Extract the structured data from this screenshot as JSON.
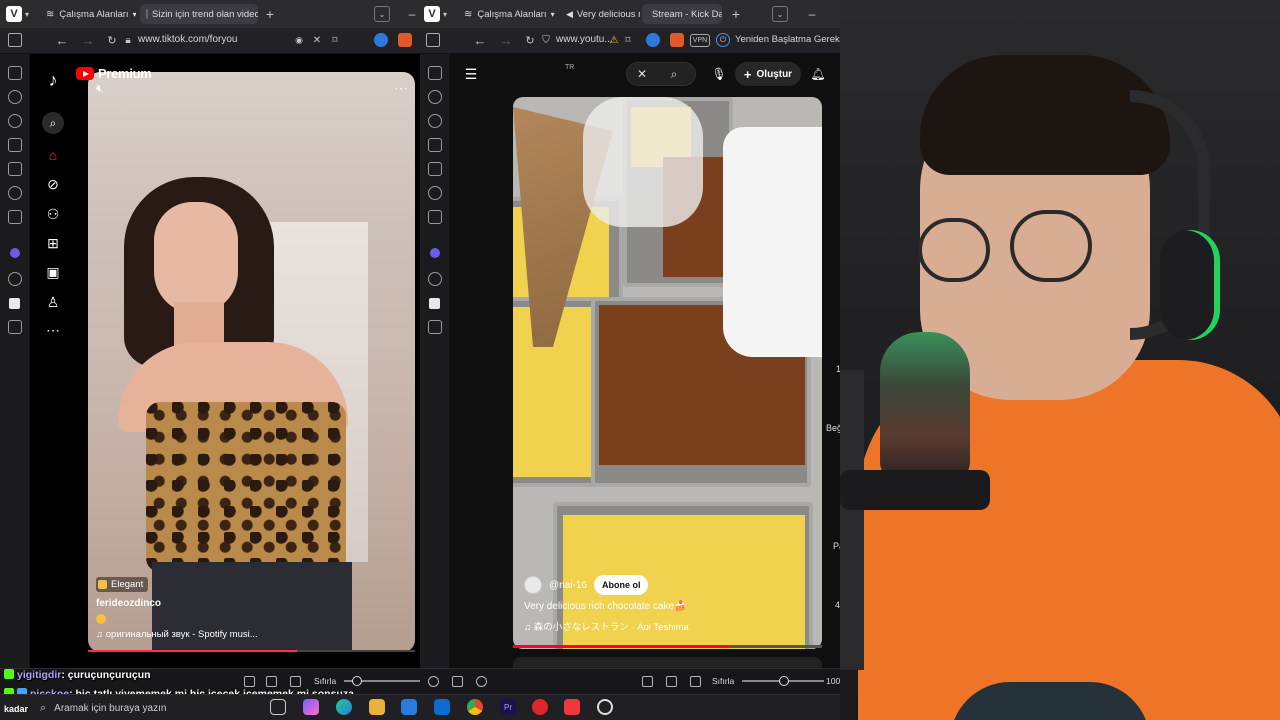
{
  "left_browser": {
    "tabs": [
      {
        "label": "Çalışma Alanları"
      },
      {
        "label": "Sizin için trend olan videolar"
      }
    ],
    "url": "www.tiktok.com/foryou"
  },
  "tiktok_video": {
    "badge": "Elegant",
    "username": "ferideozdinco",
    "sound": "оригинальный звук - Spotify musi...",
    "progress_percent": 64
  },
  "right_browser": {
    "tabs": [
      {
        "label": "Çalışma Alanları"
      },
      {
        "label": "Very delicious rich"
      },
      {
        "label": "Stream - Kick Das"
      }
    ],
    "url": "www.youtu...",
    "vpn_label": "VPN",
    "restart_notice": "Yeniden Başlatma Gerekli"
  },
  "youtube": {
    "brand": "Premium",
    "country": "TR",
    "create_label": "Oluştur",
    "channel": "@nai-16",
    "subscribe_label": "Abone ol",
    "title": "Very delicious rich chocolate cake🍰",
    "music": "♫ 森の小さなレストラン · Aoi Teshima",
    "progress_percent": 70,
    "edge_labels": [
      "1",
      "Beğ",
      "Pa",
      "4"
    ]
  },
  "obs": {
    "reset_label_left": "Sıfırla",
    "reset_label_right": "Sıfırla",
    "volume": "100",
    "left_slider_percent": 10,
    "right_slider_percent": 45
  },
  "chat": [
    {
      "user": "yigitigdir",
      "text": ": çuruçunçuruçun"
    },
    {
      "user": "picckoe",
      "text": ": hiç tatlı yiyememek mi hiç içecek içememek mi sonsuza"
    }
  ],
  "taskbar": {
    "search_placeholder": "Aramak için buraya yazın",
    "kadar": "kadar"
  },
  "colors": {
    "tiktok_red": "#fe2c55",
    "youtube_red": "#ff0000",
    "kick_green": "#53fc18",
    "shirt_orange": "#ee7428"
  }
}
